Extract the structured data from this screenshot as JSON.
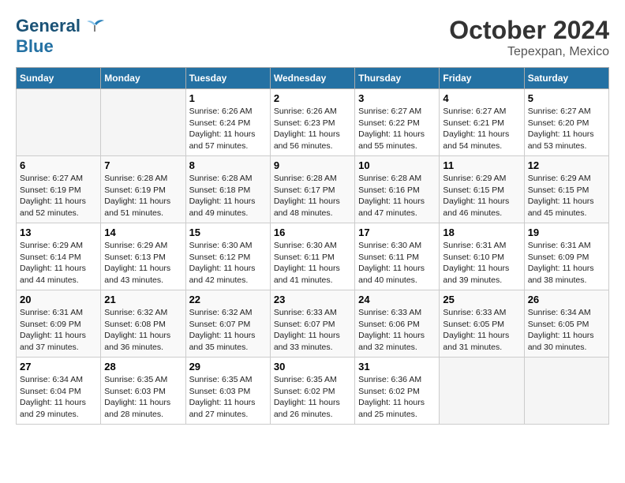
{
  "header": {
    "logo_line1": "General",
    "logo_line2": "Blue",
    "title": "October 2024",
    "subtitle": "Tepexpan, Mexico"
  },
  "weekdays": [
    "Sunday",
    "Monday",
    "Tuesday",
    "Wednesday",
    "Thursday",
    "Friday",
    "Saturday"
  ],
  "weeks": [
    [
      {
        "day": "",
        "sunrise": "",
        "sunset": "",
        "daylight": ""
      },
      {
        "day": "",
        "sunrise": "",
        "sunset": "",
        "daylight": ""
      },
      {
        "day": "1",
        "sunrise": "Sunrise: 6:26 AM",
        "sunset": "Sunset: 6:24 PM",
        "daylight": "Daylight: 11 hours and 57 minutes."
      },
      {
        "day": "2",
        "sunrise": "Sunrise: 6:26 AM",
        "sunset": "Sunset: 6:23 PM",
        "daylight": "Daylight: 11 hours and 56 minutes."
      },
      {
        "day": "3",
        "sunrise": "Sunrise: 6:27 AM",
        "sunset": "Sunset: 6:22 PM",
        "daylight": "Daylight: 11 hours and 55 minutes."
      },
      {
        "day": "4",
        "sunrise": "Sunrise: 6:27 AM",
        "sunset": "Sunset: 6:21 PM",
        "daylight": "Daylight: 11 hours and 54 minutes."
      },
      {
        "day": "5",
        "sunrise": "Sunrise: 6:27 AM",
        "sunset": "Sunset: 6:20 PM",
        "daylight": "Daylight: 11 hours and 53 minutes."
      }
    ],
    [
      {
        "day": "6",
        "sunrise": "Sunrise: 6:27 AM",
        "sunset": "Sunset: 6:19 PM",
        "daylight": "Daylight: 11 hours and 52 minutes."
      },
      {
        "day": "7",
        "sunrise": "Sunrise: 6:28 AM",
        "sunset": "Sunset: 6:19 PM",
        "daylight": "Daylight: 11 hours and 51 minutes."
      },
      {
        "day": "8",
        "sunrise": "Sunrise: 6:28 AM",
        "sunset": "Sunset: 6:18 PM",
        "daylight": "Daylight: 11 hours and 49 minutes."
      },
      {
        "day": "9",
        "sunrise": "Sunrise: 6:28 AM",
        "sunset": "Sunset: 6:17 PM",
        "daylight": "Daylight: 11 hours and 48 minutes."
      },
      {
        "day": "10",
        "sunrise": "Sunrise: 6:28 AM",
        "sunset": "Sunset: 6:16 PM",
        "daylight": "Daylight: 11 hours and 47 minutes."
      },
      {
        "day": "11",
        "sunrise": "Sunrise: 6:29 AM",
        "sunset": "Sunset: 6:15 PM",
        "daylight": "Daylight: 11 hours and 46 minutes."
      },
      {
        "day": "12",
        "sunrise": "Sunrise: 6:29 AM",
        "sunset": "Sunset: 6:15 PM",
        "daylight": "Daylight: 11 hours and 45 minutes."
      }
    ],
    [
      {
        "day": "13",
        "sunrise": "Sunrise: 6:29 AM",
        "sunset": "Sunset: 6:14 PM",
        "daylight": "Daylight: 11 hours and 44 minutes."
      },
      {
        "day": "14",
        "sunrise": "Sunrise: 6:29 AM",
        "sunset": "Sunset: 6:13 PM",
        "daylight": "Daylight: 11 hours and 43 minutes."
      },
      {
        "day": "15",
        "sunrise": "Sunrise: 6:30 AM",
        "sunset": "Sunset: 6:12 PM",
        "daylight": "Daylight: 11 hours and 42 minutes."
      },
      {
        "day": "16",
        "sunrise": "Sunrise: 6:30 AM",
        "sunset": "Sunset: 6:11 PM",
        "daylight": "Daylight: 11 hours and 41 minutes."
      },
      {
        "day": "17",
        "sunrise": "Sunrise: 6:30 AM",
        "sunset": "Sunset: 6:11 PM",
        "daylight": "Daylight: 11 hours and 40 minutes."
      },
      {
        "day": "18",
        "sunrise": "Sunrise: 6:31 AM",
        "sunset": "Sunset: 6:10 PM",
        "daylight": "Daylight: 11 hours and 39 minutes."
      },
      {
        "day": "19",
        "sunrise": "Sunrise: 6:31 AM",
        "sunset": "Sunset: 6:09 PM",
        "daylight": "Daylight: 11 hours and 38 minutes."
      }
    ],
    [
      {
        "day": "20",
        "sunrise": "Sunrise: 6:31 AM",
        "sunset": "Sunset: 6:09 PM",
        "daylight": "Daylight: 11 hours and 37 minutes."
      },
      {
        "day": "21",
        "sunrise": "Sunrise: 6:32 AM",
        "sunset": "Sunset: 6:08 PM",
        "daylight": "Daylight: 11 hours and 36 minutes."
      },
      {
        "day": "22",
        "sunrise": "Sunrise: 6:32 AM",
        "sunset": "Sunset: 6:07 PM",
        "daylight": "Daylight: 11 hours and 35 minutes."
      },
      {
        "day": "23",
        "sunrise": "Sunrise: 6:33 AM",
        "sunset": "Sunset: 6:07 PM",
        "daylight": "Daylight: 11 hours and 33 minutes."
      },
      {
        "day": "24",
        "sunrise": "Sunrise: 6:33 AM",
        "sunset": "Sunset: 6:06 PM",
        "daylight": "Daylight: 11 hours and 32 minutes."
      },
      {
        "day": "25",
        "sunrise": "Sunrise: 6:33 AM",
        "sunset": "Sunset: 6:05 PM",
        "daylight": "Daylight: 11 hours and 31 minutes."
      },
      {
        "day": "26",
        "sunrise": "Sunrise: 6:34 AM",
        "sunset": "Sunset: 6:05 PM",
        "daylight": "Daylight: 11 hours and 30 minutes."
      }
    ],
    [
      {
        "day": "27",
        "sunrise": "Sunrise: 6:34 AM",
        "sunset": "Sunset: 6:04 PM",
        "daylight": "Daylight: 11 hours and 29 minutes."
      },
      {
        "day": "28",
        "sunrise": "Sunrise: 6:35 AM",
        "sunset": "Sunset: 6:03 PM",
        "daylight": "Daylight: 11 hours and 28 minutes."
      },
      {
        "day": "29",
        "sunrise": "Sunrise: 6:35 AM",
        "sunset": "Sunset: 6:03 PM",
        "daylight": "Daylight: 11 hours and 27 minutes."
      },
      {
        "day": "30",
        "sunrise": "Sunrise: 6:35 AM",
        "sunset": "Sunset: 6:02 PM",
        "daylight": "Daylight: 11 hours and 26 minutes."
      },
      {
        "day": "31",
        "sunrise": "Sunrise: 6:36 AM",
        "sunset": "Sunset: 6:02 PM",
        "daylight": "Daylight: 11 hours and 25 minutes."
      },
      {
        "day": "",
        "sunrise": "",
        "sunset": "",
        "daylight": ""
      },
      {
        "day": "",
        "sunrise": "",
        "sunset": "",
        "daylight": ""
      }
    ]
  ]
}
